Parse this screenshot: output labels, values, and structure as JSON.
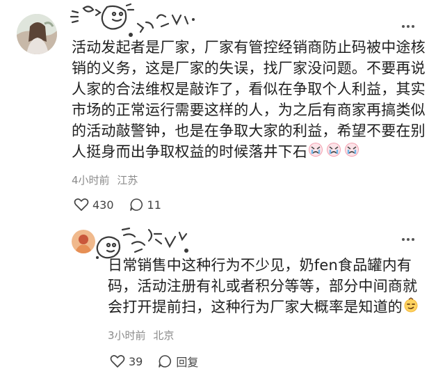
{
  "comments": [
    {
      "text": "活动发起者是厂家，厂家有管控经销商防止码被中途核销的义务，这是厂家的失误，找厂家没问题。不要再说人家的合法维权是敲诈了，看似在争取个人利益，其实市场的正常运行需要这样的人，为之后有商家再搞类似的活动敲警钟，也是在争取大家的利益，希望不要在别人挺身而出争取权益的时候落井下石",
      "time": "4小时前",
      "location": "江苏",
      "likes": "430",
      "replies": "11",
      "avatar_icon": "avatar-photo",
      "emoji_icon": "crying-face-icon"
    },
    {
      "text": "日常销售中这种行为不少见，奶fen食品罐内有码，活动注册有礼或者积分等等，部分中间商就会打开提前扫，这种行为厂家大概率是知道的",
      "time": "3小时前",
      "location": "北京",
      "likes": "39",
      "reply_label": "回复",
      "avatar_icon": "avatar-photo",
      "emoji_icon": "smirk-face-icon"
    }
  ],
  "colors": {
    "text": "#1e1e1e",
    "meta": "#8a8a8a",
    "sticker": "#3a3a3a"
  }
}
